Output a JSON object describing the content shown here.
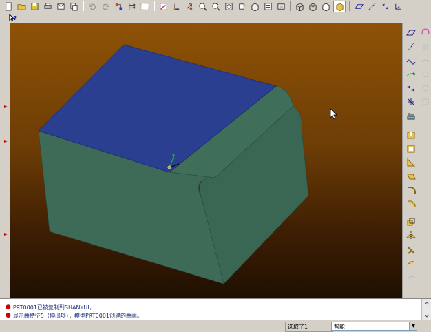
{
  "toolbar": {
    "icons_row1": [
      "new-icon",
      "open-icon",
      "save-icon",
      "print-icon",
      "email-icon",
      "copy-icon",
      "undo-icon",
      "redo-icon",
      "regenerate-icon",
      "model-tree-icon",
      "window-icon",
      "sketch-icon",
      "datum-display-icon",
      "zoom-in-icon",
      "zoom-out-icon",
      "refit-icon",
      "repaint-icon",
      "view-orient-icon",
      "saved-views-icon",
      "layers-icon",
      "wireframe-icon",
      "hidden-line-icon",
      "no-hidden-icon",
      "shading-icon",
      "datum-planes-icon",
      "datum-axes-icon",
      "datum-points-icon"
    ],
    "help_icon": "whats-this-help-icon"
  },
  "messages": [
    "PRT0001已被复制到SHANYUI。",
    "显示曲特征5（伸出项），模型PRT0001创建的曲面。"
  ],
  "status": {
    "selection": "选取了1",
    "filter": "智能"
  },
  "colors": {
    "top_face": "#2a3f8f",
    "side_face": "#3d6b57",
    "viewport_top": "#8e5206",
    "viewport_bottom": "#1f0f02"
  }
}
